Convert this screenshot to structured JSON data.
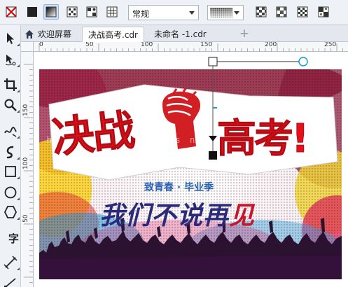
{
  "propbar": {
    "line_style_label": "常规"
  },
  "tabs": [
    {
      "label": "欢迎屏幕"
    },
    {
      "label": "决战高考.cdr"
    },
    {
      "label": "未命名 -1.cdr"
    }
  ],
  "toolbox": {
    "text_tool_glyph": "字"
  },
  "hruler": {
    "unit_labels": [
      "0",
      "50",
      "100",
      "150",
      "200",
      "250"
    ]
  },
  "vruler": {
    "unit_labels": [
      "150",
      "100",
      "50"
    ]
  },
  "poster": {
    "title_left": "决战",
    "title_right": "高考!",
    "subtitle": "致青春 · 毕业季",
    "script_main": "我们不说再",
    "script_red": "见",
    "watermark": "s h a n c s i t u . s n c h . c o m"
  },
  "colors": {
    "title_red": "#e5101a",
    "subtitle_blue": "#2a62b5",
    "script_navy": "#2b2a7a",
    "handle_cyan": "#1a9bd7"
  }
}
